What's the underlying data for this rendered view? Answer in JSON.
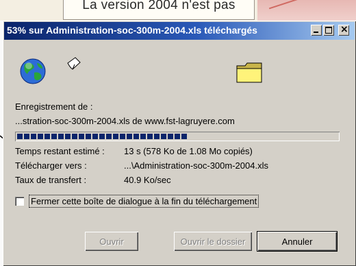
{
  "background": {
    "page_text": "La version 2004 n'est pas"
  },
  "titlebar": {
    "title": "53% sur Administration-soc-300m-2004.xls téléchargés",
    "progress_percent": 53
  },
  "saving": {
    "label": "Enregistrement de :",
    "value": "...stration-soc-300m-2004.xls de www.fst-lagruyere.com"
  },
  "progress": {
    "fraction": 0.53,
    "color": "#0a246a"
  },
  "details": {
    "time_label": "Temps restant estimé :",
    "time_value": "13 s (578 Ko de 1.08 Mo copiés)",
    "dest_label": "Télécharger vers :",
    "dest_value": "...\\Administration-soc-300m-2004.xls",
    "rate_label": "Taux de transfert :",
    "rate_value": "40.9 Ko/sec"
  },
  "options": {
    "close_when_done_label": "Fermer cette boîte de dialogue à la fin du téléchargement",
    "close_when_done_checked": false
  },
  "buttons": {
    "open": "Ouvrir",
    "open_folder": "Ouvrir le dossier",
    "cancel": "Annuler"
  },
  "icons": {
    "globe": "globe-icon",
    "paper": "flying-paper-icon",
    "folder": "folder-icon"
  }
}
